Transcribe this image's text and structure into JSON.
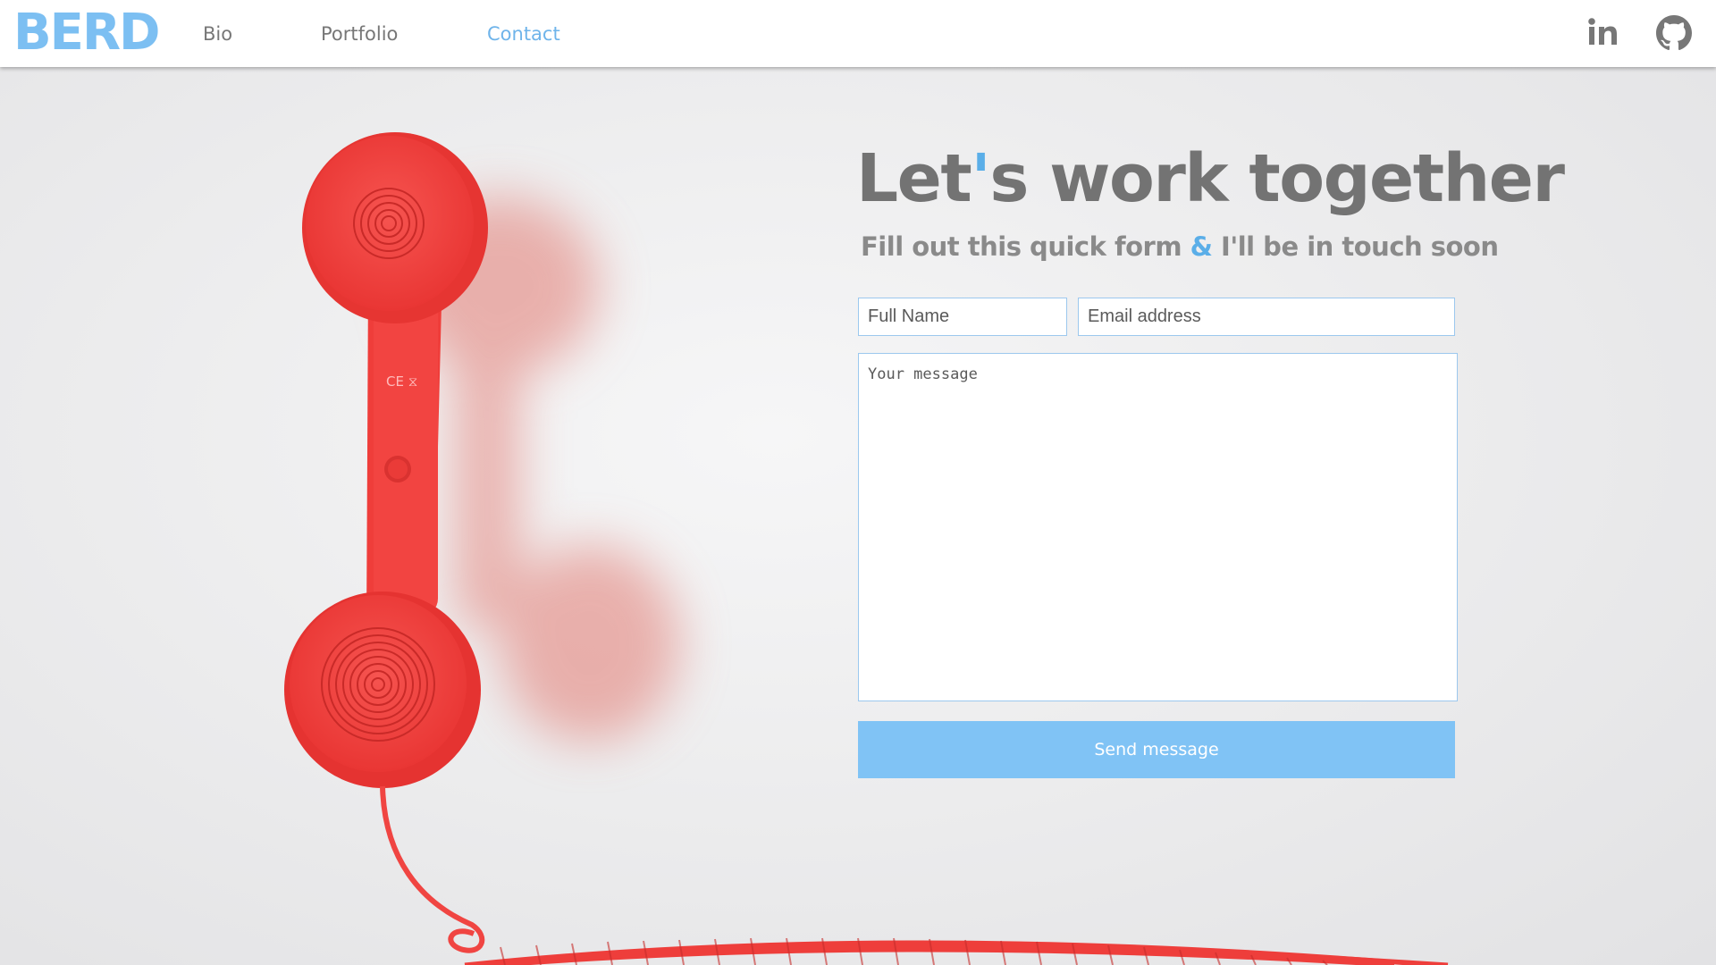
{
  "nav": {
    "logo": "BERD",
    "links": [
      {
        "label": "Bio",
        "active": false
      },
      {
        "label": "Portfolio",
        "active": false
      },
      {
        "label": "Contact",
        "active": true
      }
    ],
    "social": [
      {
        "icon": "linkedin-icon",
        "label": "in"
      },
      {
        "icon": "github-icon"
      }
    ]
  },
  "contact": {
    "heading_part1": "Let",
    "heading_apostrophe": "'",
    "heading_part2": "s work together",
    "subheading_part1": "Fill out this quick form ",
    "subheading_amp": "&",
    "subheading_part2": " I'll be in touch soon",
    "name_placeholder": "Full Name",
    "email_placeholder": "Email address",
    "message_placeholder": "Your message",
    "submit_label": "Send message"
  },
  "colors": {
    "accent": "#7cbff2",
    "button": "#80c3f5",
    "heading": "#737373",
    "phone_red": "#f0403e"
  },
  "background_image": "red-telephone-handset-with-coiled-cord"
}
